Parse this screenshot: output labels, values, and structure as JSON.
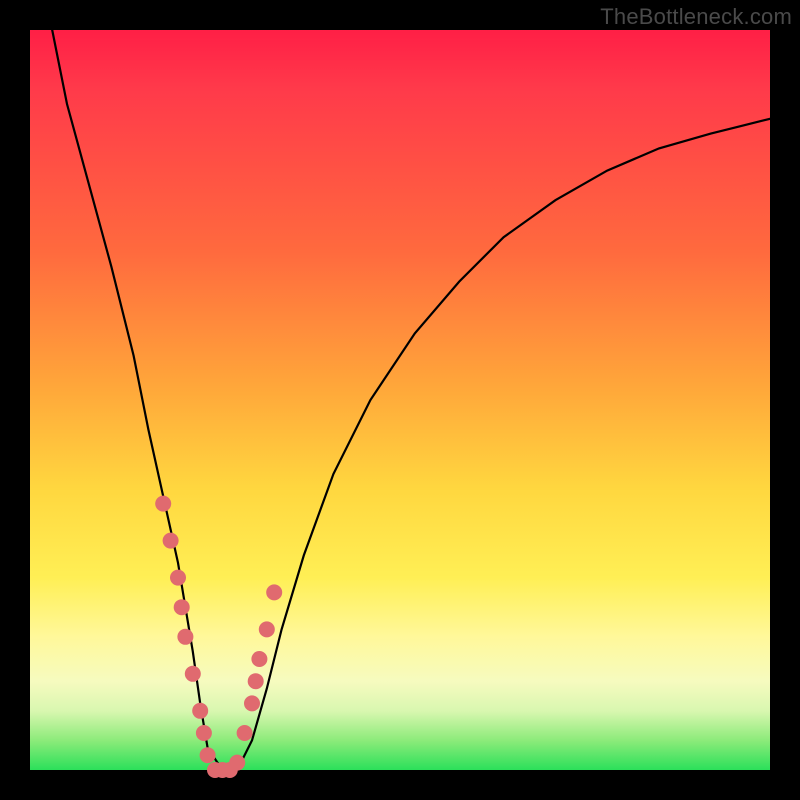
{
  "watermark": "TheBottleneck.com",
  "chart_data": {
    "type": "line",
    "title": "",
    "xlabel": "",
    "ylabel": "",
    "xlim": [
      0,
      100
    ],
    "ylim": [
      0,
      100
    ],
    "series": [
      {
        "name": "bottleneck-curve",
        "x": [
          3,
          5,
          8,
          11,
          14,
          16,
          18,
          20,
          21,
          22,
          23,
          24,
          26,
          28,
          30,
          32,
          34,
          37,
          41,
          46,
          52,
          58,
          64,
          71,
          78,
          85,
          92,
          100
        ],
        "values": [
          100,
          90,
          79,
          68,
          56,
          46,
          37,
          28,
          22,
          16,
          9,
          3,
          0,
          0,
          4,
          11,
          19,
          29,
          40,
          50,
          59,
          66,
          72,
          77,
          81,
          84,
          86,
          88
        ]
      }
    ],
    "markers": {
      "name": "highlighted-points",
      "color": "#e06a6f",
      "x": [
        18,
        19,
        20,
        20.5,
        21,
        22,
        23,
        23.5,
        24,
        25,
        26,
        27,
        28,
        29,
        30,
        30.5,
        31,
        32,
        33
      ],
      "values": [
        36,
        31,
        26,
        22,
        18,
        13,
        8,
        5,
        2,
        0,
        0,
        0,
        1,
        5,
        9,
        12,
        15,
        19,
        24
      ]
    },
    "gradient_stops": [
      {
        "pos": 0,
        "color": "#ff1f46"
      },
      {
        "pos": 30,
        "color": "#ff6a3e"
      },
      {
        "pos": 62,
        "color": "#ffd73f"
      },
      {
        "pos": 88,
        "color": "#f6fbbf"
      },
      {
        "pos": 100,
        "color": "#2be05a"
      }
    ]
  }
}
